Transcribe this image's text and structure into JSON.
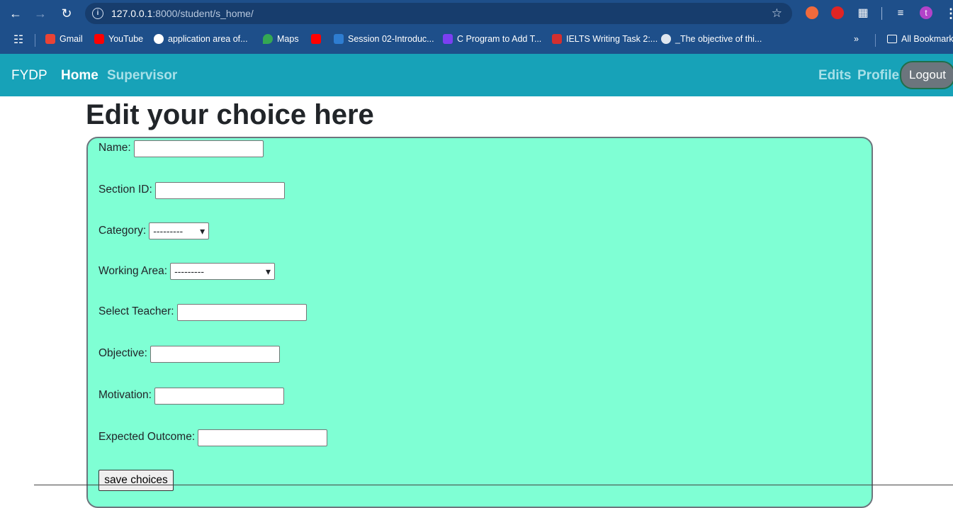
{
  "browser": {
    "url_host": "127.0.0.1",
    "url_rest": ":8000/student/s_home/",
    "profile_initial": "t",
    "bookmarks": [
      {
        "label": "Gmail",
        "color": "#ea4335"
      },
      {
        "label": "YouTube",
        "color": "#ff0000"
      },
      {
        "label": "application area of...",
        "color": "#4285f4"
      },
      {
        "label": "Maps",
        "color": "#34a853"
      },
      {
        "label": "",
        "color": "#ff0000"
      },
      {
        "label": "Session 02-Introduc...",
        "color": "#2e7dd1"
      },
      {
        "label": "C Program to Add T...",
        "color": "#7b3ff2"
      },
      {
        "label": "IELTS Writing Task 2:...",
        "color": "#d32f2f"
      },
      {
        "label": "_The objective of thi...",
        "color": "#dfe6ef"
      }
    ],
    "all_bookmarks_label": "All Bookmarks"
  },
  "navbar": {
    "brand": "FYDP",
    "home": "Home",
    "supervisor": "Supervisor",
    "edits": "Edits",
    "profile": "Profile",
    "logout": "Logout"
  },
  "page": {
    "title": "Edit your choice here"
  },
  "form": {
    "name_label": "Name:",
    "section_label": "Section ID:",
    "category_label": "Category:",
    "category_value": "---------",
    "working_area_label": "Working Area:",
    "working_area_value": "---------",
    "teacher_label": "Select Teacher:",
    "objective_label": "Objective:",
    "motivation_label": "Motivation:",
    "outcome_label": "Expected Outcome:",
    "save_label": "save choices"
  }
}
